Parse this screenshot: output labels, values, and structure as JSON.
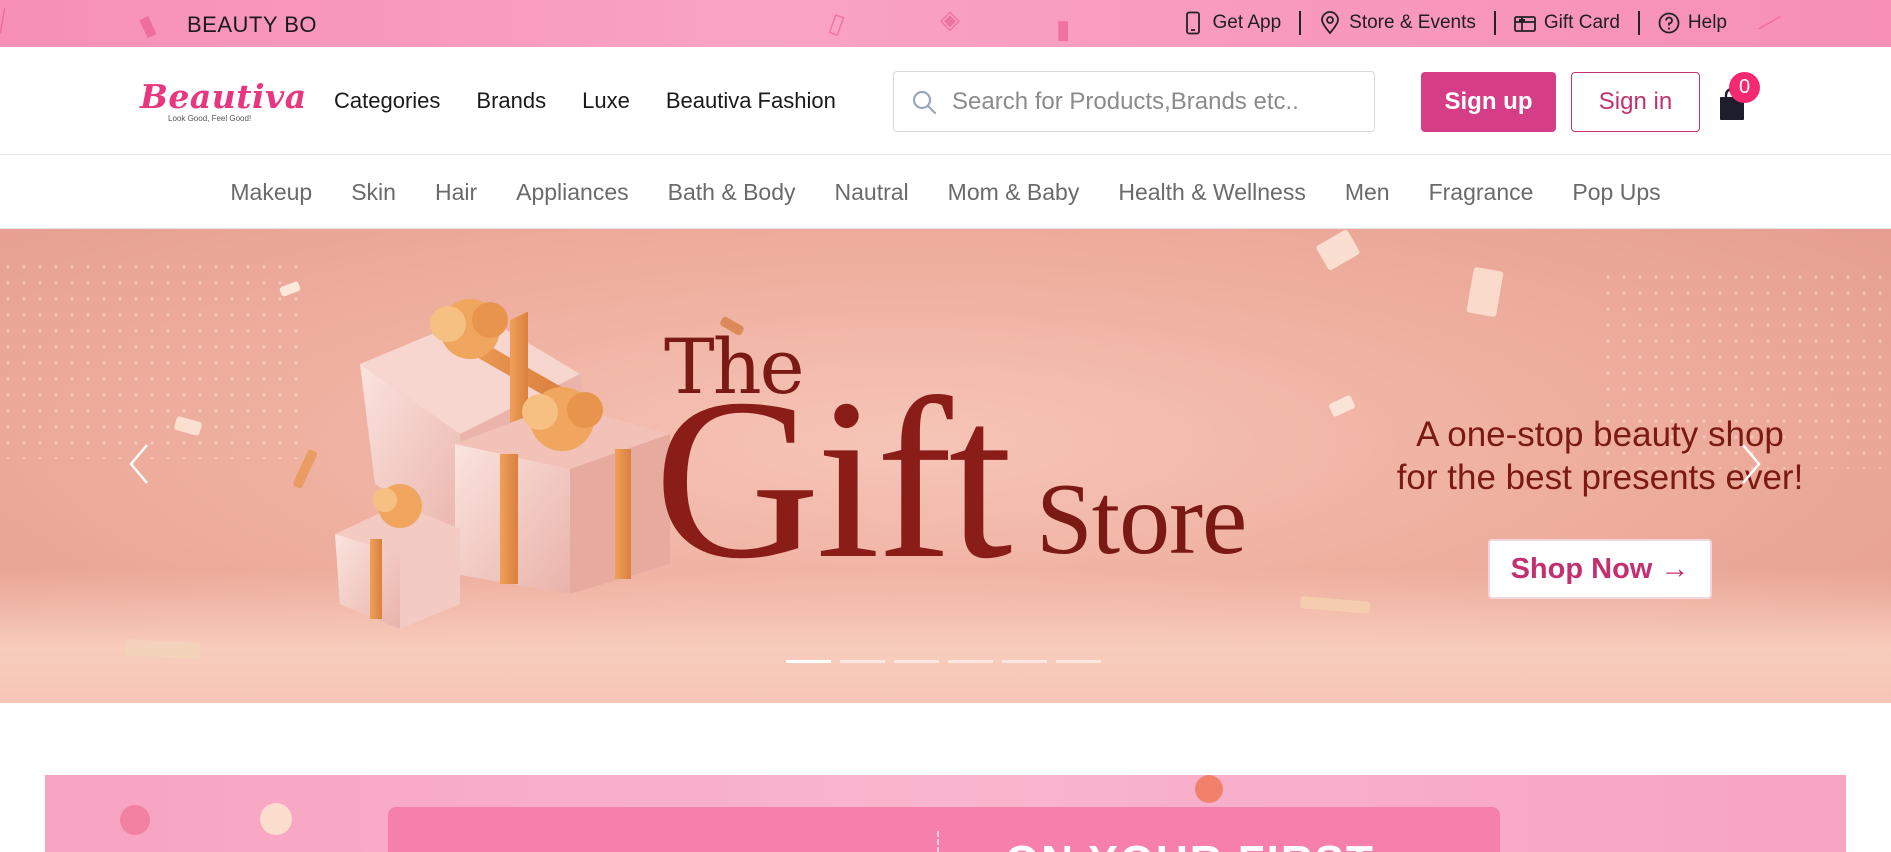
{
  "topbar": {
    "promo_text": "BEAUTY BO",
    "links": [
      {
        "label": "Get App",
        "icon": "phone-icon"
      },
      {
        "label": "Store & Events",
        "icon": "location-pin-icon"
      },
      {
        "label": "Gift Card",
        "icon": "gift-card-icon"
      },
      {
        "label": "Help",
        "icon": "help-circle-icon"
      }
    ]
  },
  "header": {
    "logo_text": "Beautiva",
    "logo_tagline": "Look Good, Feel Good!",
    "nav": [
      "Categories",
      "Brands",
      "Luxe",
      "Beautiva Fashion"
    ],
    "search_placeholder": "Search for Products,Brands etc..",
    "signup_label": "Sign up",
    "signin_label": "Sign in",
    "cart_count": "0"
  },
  "categories": [
    "Makeup",
    "Skin",
    "Hair",
    "Appliances",
    "Bath & Body",
    "Nautral",
    "Mom & Baby",
    "Health & Wellness",
    "Men",
    "Fragrance",
    "Pop Ups"
  ],
  "hero": {
    "title_the": "The",
    "title_gift": "Gift",
    "title_store": "Store",
    "tagline_line1": "A one-stop beauty shop",
    "tagline_line2": "for the best presents ever!",
    "cta_label": "Shop Now →",
    "slide_count": 6,
    "active_slide": 1
  },
  "promo_strip": {
    "text": "ON YOUR FIRST"
  },
  "colors": {
    "brand_pink": "#d53d86",
    "topbar_pink": "#f78fb6",
    "hero_text": "#8a1d18",
    "badge": "#f5296f"
  }
}
